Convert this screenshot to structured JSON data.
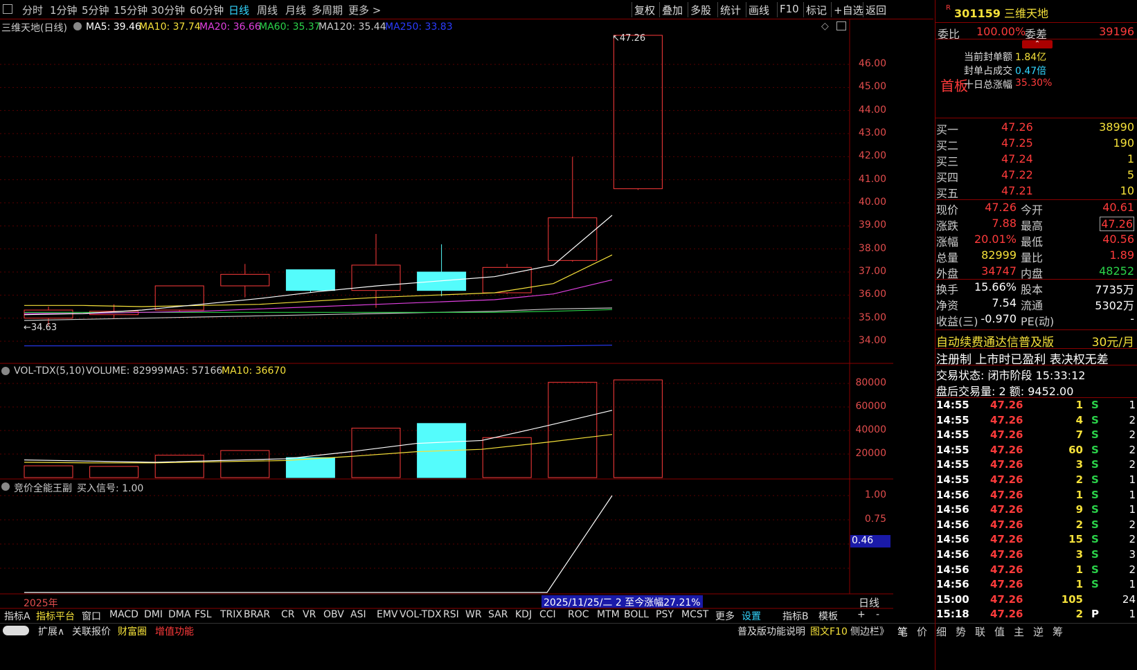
{
  "toolbar": {
    "periods": [
      "分时",
      "1分钟",
      "5分钟",
      "15分钟",
      "30分钟",
      "60分钟",
      "日线",
      "周线",
      "月线",
      "多周期",
      "更多 >"
    ],
    "active_period": "日线",
    "actions": [
      "复权",
      "叠加",
      "多股",
      "统计",
      "画线",
      "F10",
      "标记",
      "+自选",
      "返回"
    ]
  },
  "main_chart": {
    "title": "三维天地(日线)",
    "ma_labels": [
      {
        "text": "MA5: 39.46",
        "color": "#ffffff"
      },
      {
        "text": "MA10: 37.74",
        "color": "#f5e13a"
      },
      {
        "text": "MA20: 36.66",
        "color": "#e040e0"
      },
      {
        "text": "MA60: 35.37",
        "color": "#2bd34a"
      },
      {
        "text": "MA120: 35.44",
        "color": "#cccccc"
      },
      {
        "text": "MA250: 33.83",
        "color": "#2a3cff"
      }
    ],
    "high_marker": "47.26",
    "low_marker": "34.63",
    "y_ticks": [
      "46.00",
      "45.00",
      "44.00",
      "43.00",
      "42.00",
      "41.00",
      "40.00",
      "39.00",
      "38.00",
      "37.00",
      "36.00",
      "35.00",
      "34.00"
    ]
  },
  "volume_chart": {
    "labels": [
      {
        "text": "VOL-TDX(5,10)",
        "color": "#cccccc"
      },
      {
        "text": "VOLUME: 82999",
        "color": "#cccccc"
      },
      {
        "text": "MA5: 57166",
        "color": "#cccccc"
      },
      {
        "text": "MA10: 36670",
        "color": "#f5e13a"
      }
    ],
    "y_ticks": [
      "80000",
      "60000",
      "40000",
      "20000"
    ]
  },
  "indicator_chart": {
    "title": "竞价全能王副",
    "signal": "买入信号: 1.00",
    "y_ticks": [
      "1.00",
      "0.75"
    ],
    "current": "0.46"
  },
  "chart_data": {
    "type": "candlestick",
    "candles": [
      {
        "open": 35.0,
        "close": 35.35,
        "high": 35.5,
        "low": 34.63,
        "up": true
      },
      {
        "open": 35.3,
        "close": 35.15,
        "high": 35.6,
        "low": 35.0,
        "up": true
      },
      {
        "open": 35.35,
        "close": 36.4,
        "high": 36.4,
        "low": 35.3,
        "up": true
      },
      {
        "open": 36.4,
        "close": 36.9,
        "high": 37.35,
        "low": 35.9,
        "up": true
      },
      {
        "open": 37.1,
        "close": 36.2,
        "high": 37.1,
        "low": 36.1,
        "up": false
      },
      {
        "open": 36.2,
        "close": 37.3,
        "high": 38.65,
        "low": 35.45,
        "up": true
      },
      {
        "open": 37.0,
        "close": 36.2,
        "high": 38.2,
        "low": 35.95,
        "up": false
      },
      {
        "open": 36.1,
        "close": 37.2,
        "high": 37.35,
        "low": 36.05,
        "up": true
      },
      {
        "open": 37.5,
        "close": 39.35,
        "high": 42.0,
        "low": 37.45,
        "up": true
      },
      {
        "open": 40.61,
        "close": 47.26,
        "high": 47.26,
        "low": 40.56,
        "up": true
      }
    ],
    "ma5": [
      35.15,
      35.2,
      35.35,
      35.6,
      35.85,
      36.15,
      36.4,
      36.6,
      36.8,
      37.3,
      39.46
    ],
    "ma10": [
      35.55,
      35.55,
      35.5,
      35.55,
      35.6,
      35.75,
      35.9,
      36.0,
      36.1,
      36.5,
      37.74
    ],
    "ma20": [
      35.2,
      35.2,
      35.25,
      35.3,
      35.4,
      35.5,
      35.6,
      35.7,
      35.8,
      36.05,
      36.66
    ],
    "ma60": [
      35.25,
      35.25,
      35.25,
      35.25,
      35.25,
      35.25,
      35.25,
      35.25,
      35.25,
      35.3,
      35.37
    ],
    "ma120": [
      34.9,
      34.95,
      35.0,
      35.05,
      35.1,
      35.15,
      35.2,
      35.25,
      35.3,
      35.4,
      35.44
    ],
    "ma250": [
      33.8,
      33.8,
      33.8,
      33.8,
      33.8,
      33.8,
      33.8,
      33.8,
      33.8,
      33.8,
      33.83
    ],
    "volumes": [
      10000,
      9500,
      19000,
      23000,
      17000,
      42000,
      46000,
      34000,
      81000,
      82999
    ],
    "vol_ma5": [
      15000,
      14000,
      13000,
      14500,
      16000,
      22000,
      29000,
      31500,
      44000,
      57166
    ],
    "vol_ma10": [
      13000,
      12500,
      12500,
      13500,
      14500,
      18000,
      22000,
      24000,
      30000,
      36670
    ],
    "indicator": [
      0,
      0,
      0,
      0,
      0,
      0,
      0,
      0,
      0,
      1.0
    ],
    "ylim": [
      33.7,
      47.6
    ],
    "vol_ylim": [
      0,
      88000
    ]
  },
  "footer": {
    "year_label": "2025年",
    "period_label": "日线",
    "date_info": "2025/11/25/二 2 至今涨幅27.21%",
    "indicator_tabs": [
      "指标A",
      "指标平台",
      "窗口",
      "MACD",
      "DMI",
      "DMA",
      "FSL",
      "TRIX",
      "BRAR",
      "CR",
      "VR",
      "OBV",
      "ASI",
      "EMV",
      "VOL-TDX",
      "RSI",
      "WR",
      "SAR",
      "KDJ",
      "CCI",
      "ROC",
      "MTM",
      "BOLL",
      "PSY",
      "MCST",
      "更多",
      "设置",
      "指标B",
      "模板",
      "+",
      "-"
    ],
    "bottom_left": [
      "扩展∧",
      "关联报价",
      "财富圈",
      "增值功能"
    ],
    "bottom_right": [
      "普及版功能说明",
      "图文F10",
      "侧边栏》"
    ],
    "side_tabs": [
      "笔",
      "价",
      "细",
      "势",
      "联",
      "值",
      "主",
      "逆",
      "筹"
    ]
  },
  "quote": {
    "badge": "R",
    "code": "301159",
    "name": "三维天地",
    "weibi_label": "委比",
    "weibi": "100.00%",
    "weicha_label": "委差",
    "weicha": "39196",
    "board": "首板",
    "seal_items": [
      {
        "label": "当前封单额",
        "value": "1.84亿",
        "color": "#f5e13a"
      },
      {
        "label": "封单占成交",
        "value": "0.47倍",
        "color": "#33d6ff"
      },
      {
        "label": "十日总涨幅",
        "value": "35.30%",
        "color": "#ff3b3b"
      }
    ],
    "bids": [
      {
        "label": "买一",
        "price": "47.26",
        "vol": "38990"
      },
      {
        "label": "买二",
        "price": "47.25",
        "vol": "190"
      },
      {
        "label": "买三",
        "price": "47.24",
        "vol": "1"
      },
      {
        "label": "买四",
        "price": "47.22",
        "vol": "5"
      },
      {
        "label": "买五",
        "price": "47.21",
        "vol": "10"
      }
    ],
    "stats": [
      {
        "l1": "现价",
        "v1": "47.26",
        "c1": "#ff3b3b",
        "l2": "今开",
        "v2": "40.61",
        "c2": "#ff3b3b"
      },
      {
        "l1": "涨跌",
        "v1": "7.88",
        "c1": "#ff3b3b",
        "l2": "最高",
        "v2": "47.26",
        "c2": "#ff3b3b"
      },
      {
        "l1": "涨幅",
        "v1": "20.01%",
        "c1": "#ff3b3b",
        "l2": "最低",
        "v2": "40.56",
        "c2": "#ff3b3b"
      },
      {
        "l1": "总量",
        "v1": "82999",
        "c1": "#f5e13a",
        "l2": "量比",
        "v2": "1.89",
        "c2": "#ff3b3b"
      },
      {
        "l1": "外盘",
        "v1": "34747",
        "c1": "#ff3b3b",
        "l2": "内盘",
        "v2": "48252",
        "c2": "#2bd34a"
      }
    ],
    "fund": [
      {
        "l1": "换手",
        "v1": "15.66%",
        "l2": "股本",
        "v2": "7735万"
      },
      {
        "l1": "净资",
        "v1": "7.54",
        "l2": "流通",
        "v2": "5302万"
      },
      {
        "l1": "收益(三)",
        "v1": "-0.970",
        "l2": "PE(动)",
        "v2": "-"
      }
    ],
    "promo": "自动续费通达信普及版",
    "promo_price": "30元/月",
    "notice": "注册制 上市时已盈利 表决权无差",
    "trade_state": "交易状态: 闭市阶段 15:33:12",
    "after_hours": "盘后交易量: 2  额: 9452.00",
    "ticks": [
      {
        "t": "14:55",
        "p": "47.26",
        "v": "1",
        "d": "S",
        "n": "1"
      },
      {
        "t": "14:55",
        "p": "47.26",
        "v": "4",
        "d": "S",
        "n": "2"
      },
      {
        "t": "14:55",
        "p": "47.26",
        "v": "7",
        "d": "S",
        "n": "2"
      },
      {
        "t": "14:55",
        "p": "47.26",
        "v": "60",
        "d": "S",
        "n": "2"
      },
      {
        "t": "14:55",
        "p": "47.26",
        "v": "3",
        "d": "S",
        "n": "2"
      },
      {
        "t": "14:55",
        "p": "47.26",
        "v": "2",
        "d": "S",
        "n": "1"
      },
      {
        "t": "14:56",
        "p": "47.26",
        "v": "1",
        "d": "S",
        "n": "1"
      },
      {
        "t": "14:56",
        "p": "47.26",
        "v": "9",
        "d": "S",
        "n": "1"
      },
      {
        "t": "14:56",
        "p": "47.26",
        "v": "2",
        "d": "S",
        "n": "2"
      },
      {
        "t": "14:56",
        "p": "47.26",
        "v": "15",
        "d": "S",
        "n": "2"
      },
      {
        "t": "14:56",
        "p": "47.26",
        "v": "3",
        "d": "S",
        "n": "3"
      },
      {
        "t": "14:56",
        "p": "47.26",
        "v": "1",
        "d": "S",
        "n": "2"
      },
      {
        "t": "14:56",
        "p": "47.26",
        "v": "1",
        "d": "S",
        "n": "1"
      },
      {
        "t": "15:00",
        "p": "47.26",
        "v": "105",
        "d": "",
        "n": "24"
      },
      {
        "t": "15:18",
        "p": "47.26",
        "v": "2",
        "d": "P",
        "n": "1"
      }
    ]
  }
}
